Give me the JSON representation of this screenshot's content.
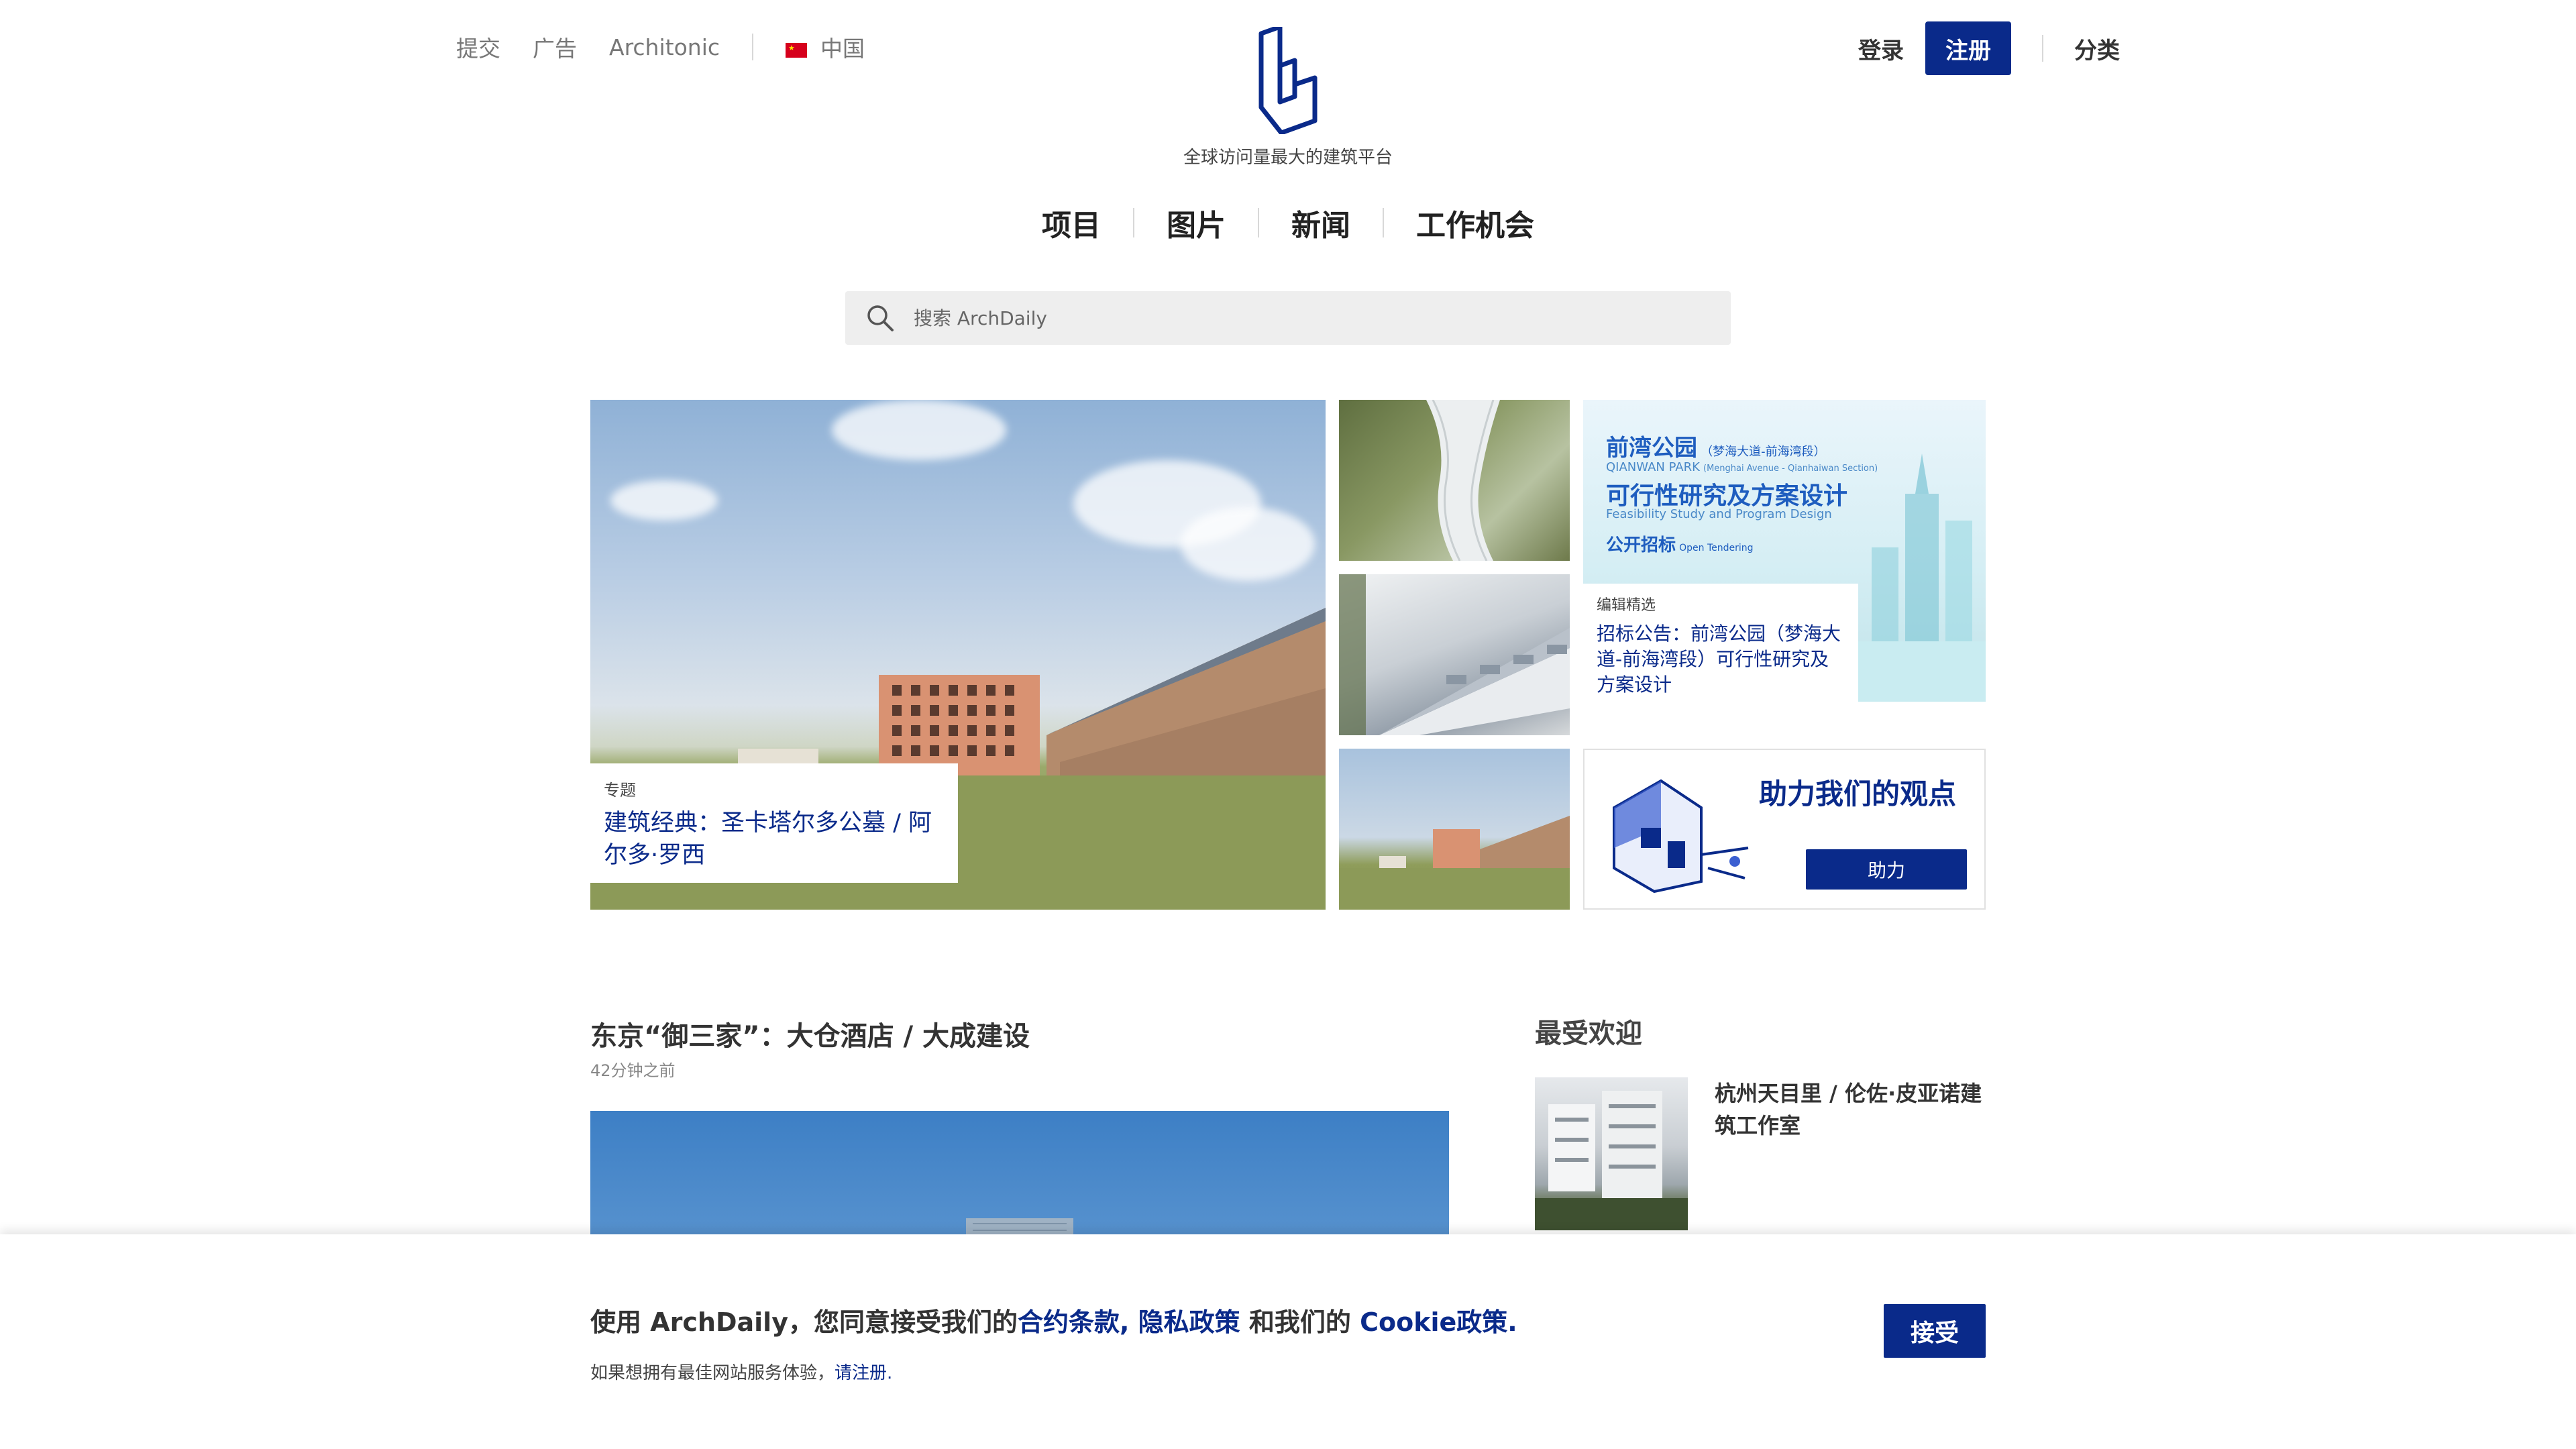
{
  "topnav": {
    "submit": "提交",
    "advertise": "广告",
    "architonic": "Architonic",
    "region": "中国"
  },
  "brand": {
    "tagline": "全球访问量最大的建筑平台"
  },
  "account": {
    "login": "登录",
    "register": "注册",
    "categories": "分类"
  },
  "mainnav": [
    "项目",
    "图片",
    "新闻",
    "工作机会"
  ],
  "search": {
    "placeholder": "搜索 ArchDaily"
  },
  "hero": {
    "kicker": "专题",
    "title": "建筑经典：圣卡塔尔多公墓 / 阿尔多·罗西"
  },
  "ad": {
    "headline_cn": "前湾公园",
    "headline_sub": "（梦海大道-前海湾段）",
    "headline_en": "QIANWAN PARK",
    "headline_en_sub": "(Menghai Avenue - Qianhaiwan Section)",
    "study_cn": "可行性研究及方案设计",
    "study_en": "Feasibility Study and Program Design",
    "tender_cn": "公开招标",
    "tender_en": "Open Tendering",
    "kicker": "编辑精选",
    "title": "招标公告：前湾公园（梦海大道-前海湾段）可行性研究及方案设计"
  },
  "promo": {
    "title": "助力我们的观点",
    "button": "助力"
  },
  "article": {
    "title": "东京“御三家”：大仓酒店 / 大成建设",
    "time": "42分钟之前"
  },
  "popular": {
    "heading": "最受欢迎",
    "items": [
      {
        "title": "杭州天目里 / 伦佐·皮亚诺建筑工作室"
      }
    ]
  },
  "cookie": {
    "text_prefix": "使用 ArchDaily，您同意接受我们的",
    "link_terms": "合约条款,",
    "link_privacy": "隐私政策",
    "text_mid": " 和我们的 ",
    "link_cookie": "Cookie政策.",
    "sub_prefix": "如果想拥有最佳网站服务体验，",
    "sub_link": "请注册.",
    "accept": "接受"
  },
  "colors": {
    "brand_blue": "#0a2a8a",
    "text_dark": "#333333",
    "text_muted": "#777777",
    "search_bg": "#eeeeee"
  },
  "icons": {
    "logo": "archdaily-logo-icon",
    "search": "search-icon",
    "flag": "china-flag-icon"
  }
}
